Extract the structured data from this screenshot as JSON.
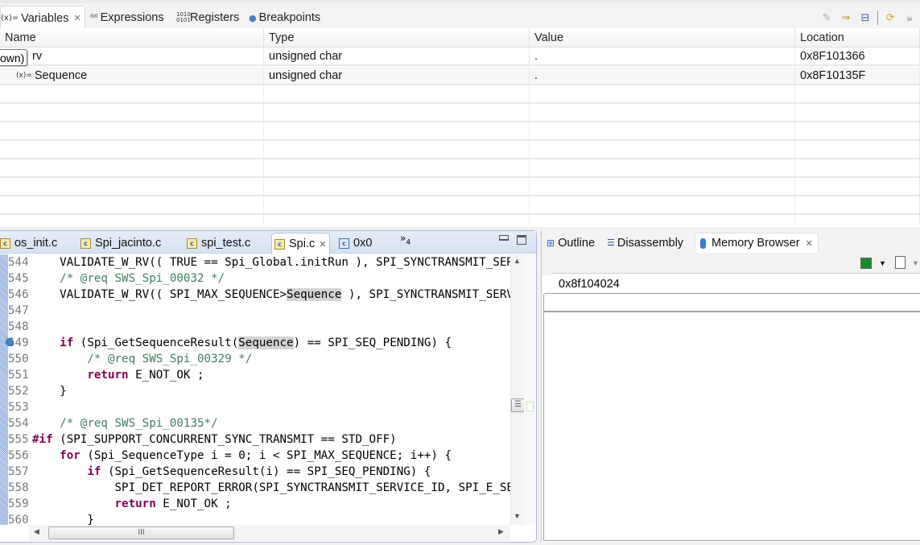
{
  "variables_view": {
    "tabs": [
      {
        "label": "Variables",
        "icon": "variables-icon",
        "active": true,
        "closable": true
      },
      {
        "label": "Expressions",
        "icon": "expressions-icon",
        "active": false
      },
      {
        "label": "Registers",
        "icon": "registers-icon",
        "active": false
      },
      {
        "label": "Breakpoints",
        "icon": "breakpoints-icon",
        "active": false
      }
    ],
    "toolbar_icons": [
      "show-type-names-icon",
      "add-global-variables-icon",
      "collapse-all-icon",
      "refresh-icon",
      "lock-icon"
    ],
    "columns": [
      "Name",
      "Type",
      "Value",
      "Location"
    ],
    "rows": [
      {
        "name": "rv",
        "type": "unsigned char",
        "value": ".",
        "location": "0x8F101366",
        "tooltip": "own)"
      },
      {
        "name": "Sequence",
        "type": "unsigned char",
        "value": ".",
        "location": "0x8F10135F"
      }
    ]
  },
  "editor": {
    "tabs": [
      {
        "label": "os_init.c",
        "active": false
      },
      {
        "label": "Spi_jacinto.c",
        "active": false
      },
      {
        "label": "spi_test.c",
        "active": false
      },
      {
        "label": "Spi.c",
        "active": true,
        "closable": true
      },
      {
        "label": "0x0",
        "active": false
      }
    ],
    "overflow_count": "4",
    "lines": [
      {
        "n": "544",
        "segments": [
          {
            "t": "    VALIDATE_W_RV(( TRUE == Spi_Global.initRun ), SPI_SYNCTRANSMIT_SERVICE_ID"
          }
        ]
      },
      {
        "n": "545",
        "segments": [
          {
            "t": "    "
          },
          {
            "t": "/* @req SWS_Spi_00032 */",
            "c": "cm"
          }
        ]
      },
      {
        "n": "546",
        "segments": [
          {
            "t": "    VALIDATE_W_RV(( SPI_MAX_SEQUENCE>"
          },
          {
            "t": "Sequence",
            "c": "hl"
          },
          {
            "t": " ), SPI_SYNCTRANSMIT_SERVICE_ID"
          }
        ]
      },
      {
        "n": "547",
        "segments": []
      },
      {
        "n": "548",
        "segments": []
      },
      {
        "n": "549",
        "segments": [
          {
            "t": "    "
          },
          {
            "t": "if",
            "c": "kw"
          },
          {
            "t": " (Spi_GetSequenceResult("
          },
          {
            "t": "Sequence",
            "c": "hl"
          },
          {
            "t": ") == SPI_SEQ_PENDING) {"
          }
        ],
        "marker": true
      },
      {
        "n": "550",
        "segments": [
          {
            "t": "        "
          },
          {
            "t": "/* @req SWS_Spi_00329 */",
            "c": "cm"
          }
        ]
      },
      {
        "n": "551",
        "segments": [
          {
            "t": "        "
          },
          {
            "t": "return",
            "c": "kw"
          },
          {
            "t": " E_NOT_OK ;"
          }
        ]
      },
      {
        "n": "552",
        "segments": [
          {
            "t": "    }"
          }
        ]
      },
      {
        "n": "553",
        "segments": []
      },
      {
        "n": "554",
        "segments": [
          {
            "t": "    "
          },
          {
            "t": "/* @req SWS_Spi_00135*/",
            "c": "cm"
          }
        ]
      },
      {
        "n": "555",
        "segments": [
          {
            "t": "#if",
            "c": "kw"
          },
          {
            "t": " (SPI_SUPPORT_CONCURRENT_SYNC_TRANSMIT == STD_OFF)"
          }
        ]
      },
      {
        "n": "556",
        "segments": [
          {
            "t": "    "
          },
          {
            "t": "for",
            "c": "kw"
          },
          {
            "t": " (Spi_SequenceType i = 0; i < SPI_MAX_SEQUENCE; i++) {"
          }
        ]
      },
      {
        "n": "557",
        "segments": [
          {
            "t": "        "
          },
          {
            "t": "if",
            "c": "kw"
          },
          {
            "t": " (Spi_GetSequenceResult(i) == SPI_SEQ_PENDING) {"
          }
        ]
      },
      {
        "n": "558",
        "segments": [
          {
            "t": "            SPI_DET_REPORT_ERROR(SPI_SYNCTRANSMIT_SERVICE_ID, SPI_E_SEQ_PENDING"
          }
        ]
      },
      {
        "n": "559",
        "segments": [
          {
            "t": "            "
          },
          {
            "t": "return",
            "c": "kw"
          },
          {
            "t": " E_NOT_OK ;"
          }
        ]
      },
      {
        "n": "560",
        "segments": [
          {
            "t": "        }"
          }
        ]
      }
    ]
  },
  "memory_panel": {
    "tabs": [
      {
        "label": "Outline",
        "icon": "outline-icon",
        "active": false
      },
      {
        "label": "Disassembly",
        "icon": "disassembly-icon",
        "active": false
      },
      {
        "label": "Memory Browser",
        "icon": "memory-icon",
        "active": true,
        "closable": true
      }
    ],
    "address": "0x8f104024"
  },
  "colors": {
    "keyword": "#7f0055",
    "comment": "#3f7f5f",
    "line_number": "#787878",
    "highlight": "#d4d4d4"
  }
}
